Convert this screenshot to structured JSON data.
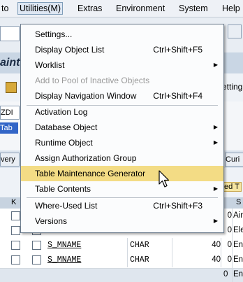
{
  "menubar": {
    "items": [
      {
        "label": "to"
      },
      {
        "label": "Utilities(M)"
      },
      {
        "label": "Extras"
      },
      {
        "label": "Environment"
      },
      {
        "label": "System"
      },
      {
        "label": "Help"
      }
    ]
  },
  "background": {
    "title_fragment": "aint",
    "tab_fragment_right": "etting",
    "field_fragment": "ZDI",
    "tab_label_fragment": "Tab",
    "btn_left": "very",
    "btn_right": "Curi",
    "right_fragment": "ed T",
    "col_header_k": "K",
    "col_header_s": "S",
    "rows": [
      {
        "field": "",
        "type": "",
        "len": "",
        "dec": "0",
        "desc": "Air"
      },
      {
        "field": "",
        "type": "",
        "len": "",
        "dec": "0",
        "desc": "Ele"
      },
      {
        "field": "S_MNAME",
        "type": "CHAR",
        "len": "40",
        "dec": "0",
        "desc": "En"
      },
      {
        "field": "S_MNAME",
        "type": "CHAR",
        "len": "40",
        "dec": "0",
        "desc": "En"
      },
      {
        "field": "",
        "type": "",
        "len": "",
        "dec": "0",
        "desc": "En"
      }
    ]
  },
  "dropdown": {
    "items": [
      {
        "label": "Settings...",
        "shortcut": ""
      },
      {
        "label": "Display Object List",
        "shortcut": "Ctrl+Shift+F5"
      },
      {
        "label": "Worklist",
        "shortcut": ""
      },
      {
        "label": "Add to Pool of Inactive Objects",
        "shortcut": ""
      },
      {
        "label": "Display Navigation Window",
        "shortcut": "Ctrl+Shift+F4"
      },
      {
        "label": "Activation Log",
        "shortcut": ""
      },
      {
        "label": "Database Object",
        "shortcut": ""
      },
      {
        "label": "Runtime Object",
        "shortcut": ""
      },
      {
        "label": "Assign Authorization Group",
        "shortcut": ""
      },
      {
        "label": "Table Maintenance Generator",
        "shortcut": ""
      },
      {
        "label": "Table Contents",
        "shortcut": ""
      },
      {
        "label": "Where-Used List",
        "shortcut": "Ctrl+Shift+F3"
      },
      {
        "label": "Versions",
        "shortcut": ""
      }
    ],
    "highlighted": "Table Maintenance Generator"
  },
  "colors": {
    "highlight": "#f3dc85",
    "menu_bg": "#fbfcfd",
    "app_bg": "#dfe6ee"
  },
  "icons": [
    "submenu-arrow-icon",
    "mouse-cursor-icon"
  ]
}
